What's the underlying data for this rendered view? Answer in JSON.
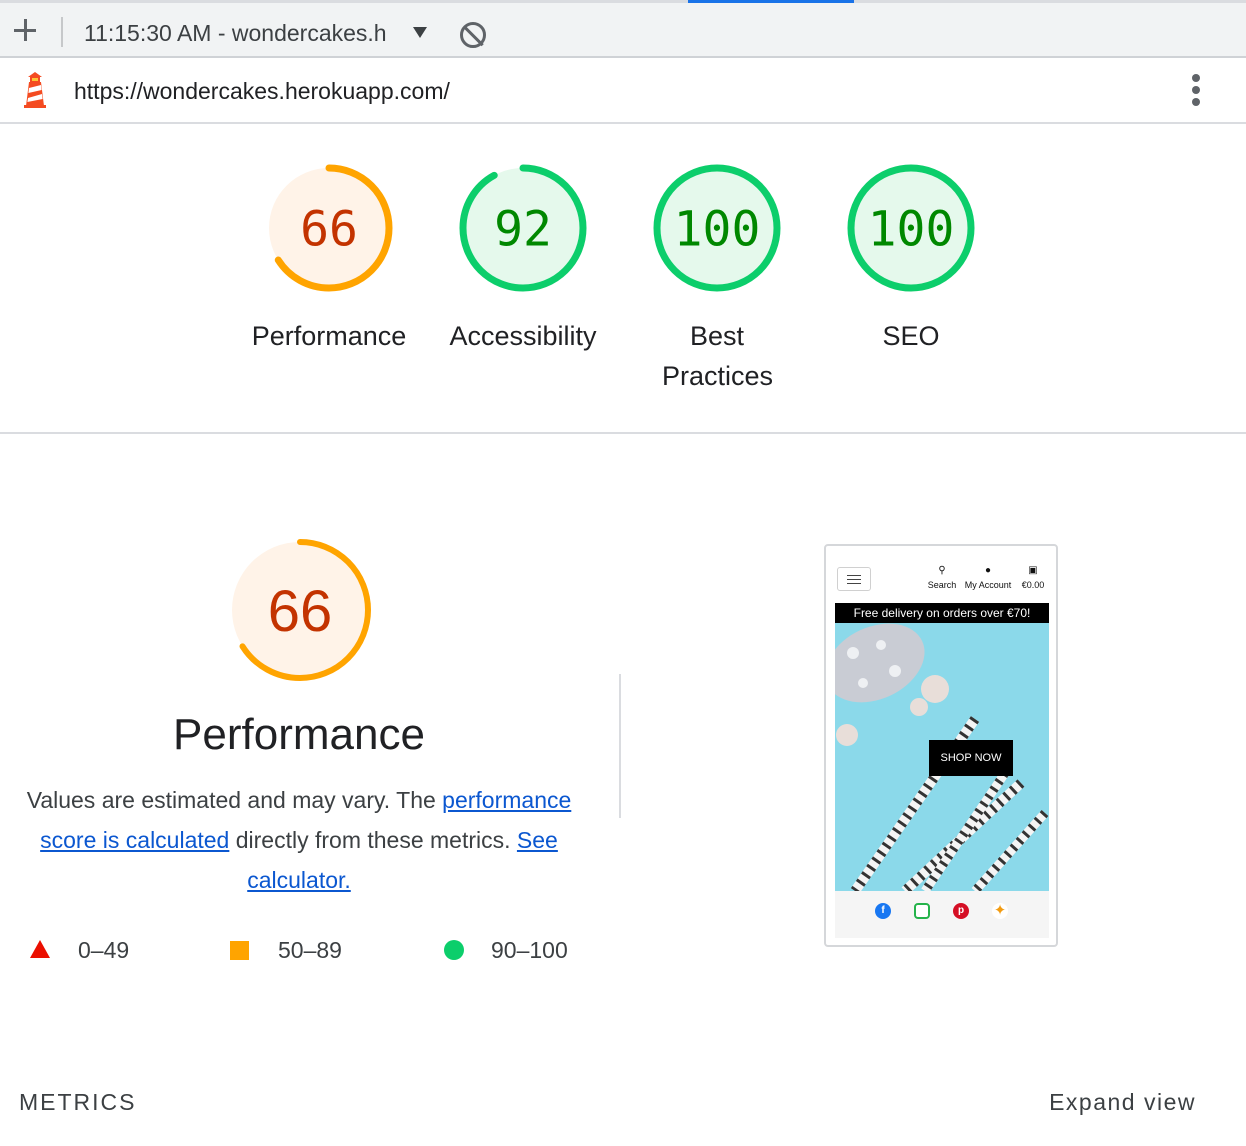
{
  "toolbar": {
    "report_label": "11:15:30 AM - wondercakes.h",
    "new_icon": "plus-icon",
    "dropdown_icon": "caret-down-icon",
    "clear_icon": "block-icon"
  },
  "urlbar": {
    "url": "https://wondercakes.herokuapp.com/",
    "logo_icon": "lighthouse-icon",
    "menu_icon": "kebab-menu-icon"
  },
  "gauges": [
    {
      "score": "66",
      "label": "Performance",
      "status": "average",
      "fraction": 0.66
    },
    {
      "score": "92",
      "label": "Accessibility",
      "status": "pass",
      "fraction": 0.92
    },
    {
      "score": "100",
      "label": "Best Practices",
      "status": "pass",
      "fraction": 1.0
    },
    {
      "score": "100",
      "label": "SEO",
      "status": "pass",
      "fraction": 1.0
    }
  ],
  "performance": {
    "score": "66",
    "fraction": 0.66,
    "title": "Performance",
    "desc_prefix": "Values are estimated and may vary. The ",
    "desc_link": "performance score is calculated",
    "desc_middle": " directly from these metrics. ",
    "calc_link": "See calculator."
  },
  "legend": [
    {
      "range": "0–49",
      "shape": "triangle",
      "color": "#eb0f00"
    },
    {
      "range": "50–89",
      "shape": "square",
      "color": "#ffa400"
    },
    {
      "range": "90–100",
      "shape": "circle",
      "color": "#0cce6b"
    }
  ],
  "thumbnail": {
    "nav": {
      "search": "Search",
      "account": "My Account",
      "cart": "€0.00"
    },
    "banner": "Free delivery on orders over €70!",
    "cta": "SHOP NOW",
    "social_icons": [
      "facebook-icon",
      "instagram-icon",
      "pinterest-icon",
      "twitter-icon"
    ]
  },
  "metrics": {
    "heading": "METRICS",
    "expand": "Expand view"
  },
  "colors": {
    "average": "#ffa400",
    "average_text": "#c33300",
    "average_bg": "#fff3e8",
    "pass": "#0cce6b",
    "pass_text": "#008800",
    "pass_bg": "#e5f9ec",
    "link": "#0b57d0",
    "active_tab": "#1a73e8"
  }
}
